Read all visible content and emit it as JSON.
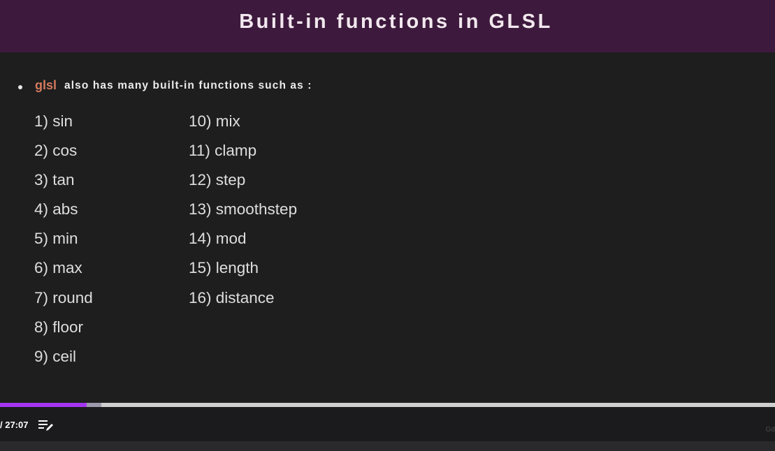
{
  "slide": {
    "title": "Built-in functions in GLSL",
    "keyword": "glsl",
    "intro": "also has many built-in functions such as :",
    "column_1": [
      "1) sin",
      "2) cos",
      "3) tan",
      "4) abs",
      "5) min",
      "6) max",
      "7) round",
      "8) floor",
      "9) ceil"
    ],
    "column_2": [
      "10) mix",
      "11) clamp",
      "12) step",
      "13) smoothstep",
      "14) mod",
      "15) length",
      "16) distance"
    ]
  },
  "player": {
    "time_display": "/ 27:07",
    "played_fraction": 0.112,
    "buffered_fraction": 0.131,
    "transcript_icon": "transcript-notes-icon",
    "corner_text": "Gd",
    "colors": {
      "progress": "#a435f0",
      "buffer": "#9d9aab",
      "track": "#cfcfcf",
      "header": "#3d1a3d",
      "keyword": "#d37a5e"
    }
  }
}
